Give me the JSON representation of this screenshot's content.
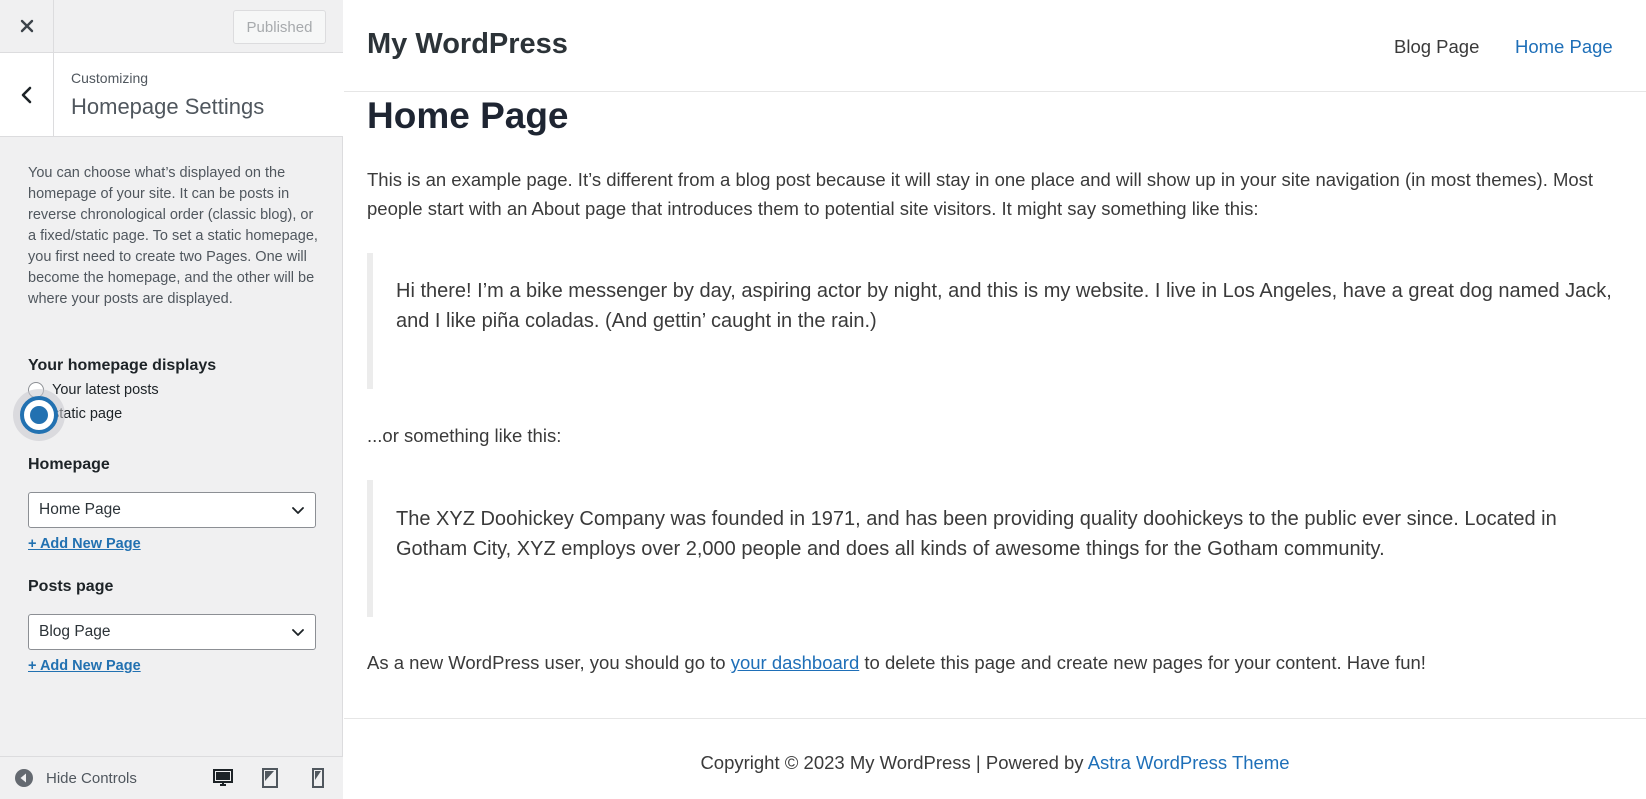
{
  "sidebar": {
    "publish_label": "Published",
    "customizing_label": "Customizing",
    "section_title": "Homepage Settings",
    "description": "You can choose what’s displayed on the homepage of your site. It can be posts in reverse chronological order (classic blog), or a fixed/static page. To set a static homepage, you first need to create two Pages. One will become the homepage, and the other will be where your posts are displayed.",
    "homepage_displays": {
      "title": "Your homepage displays",
      "options": [
        "Your latest posts",
        "A static page"
      ],
      "selected": "A static page",
      "visible_labels": [
        "Your latest posts",
        "static page"
      ]
    },
    "homepage": {
      "title": "Homepage",
      "selected": "Home Page",
      "add_link": "+ Add New Page"
    },
    "posts_page": {
      "title": "Posts page",
      "selected": "Blog Page",
      "add_link": "+ Add New Page"
    },
    "footer": {
      "hide_controls": "Hide Controls"
    }
  },
  "preview": {
    "site_title": "My WordPress",
    "nav": [
      {
        "label": "Blog Page",
        "active": false
      },
      {
        "label": "Home Page",
        "active": true
      }
    ],
    "page_heading": "Home Page",
    "intro": "This is an example page. It’s different from a blog post because it will stay in one place and will show up in your site navigation (in most themes). Most people start with an About page that introduces them to potential site visitors. It might say something like this:",
    "quote1": "Hi there! I’m a bike messenger by day, aspiring actor by night, and this is my website. I live in Los Angeles, have a great dog named Jack, and I like piña coladas. (And gettin’ caught in the rain.)",
    "or_text": "...or something like this:",
    "quote2": "The XYZ Doohickey Company was founded in 1971, and has been providing quality doohickeys to the public ever since. Located in Gotham City, XYZ employs over 2,000 people and does all kinds of awesome things for the Gotham community.",
    "closing": {
      "before": "As a new WordPress user, you should go to ",
      "link": "your dashboard",
      "after": " to delete this page and create new pages for your content. Have fun!"
    },
    "footer": {
      "text": "Copyright © 2023 My WordPress | Powered by ",
      "link": "Astra WordPress Theme"
    }
  },
  "colors": {
    "accent": "#2271b1",
    "link": "#1e6fb8",
    "sidebar_bg": "#f0f0f1"
  }
}
